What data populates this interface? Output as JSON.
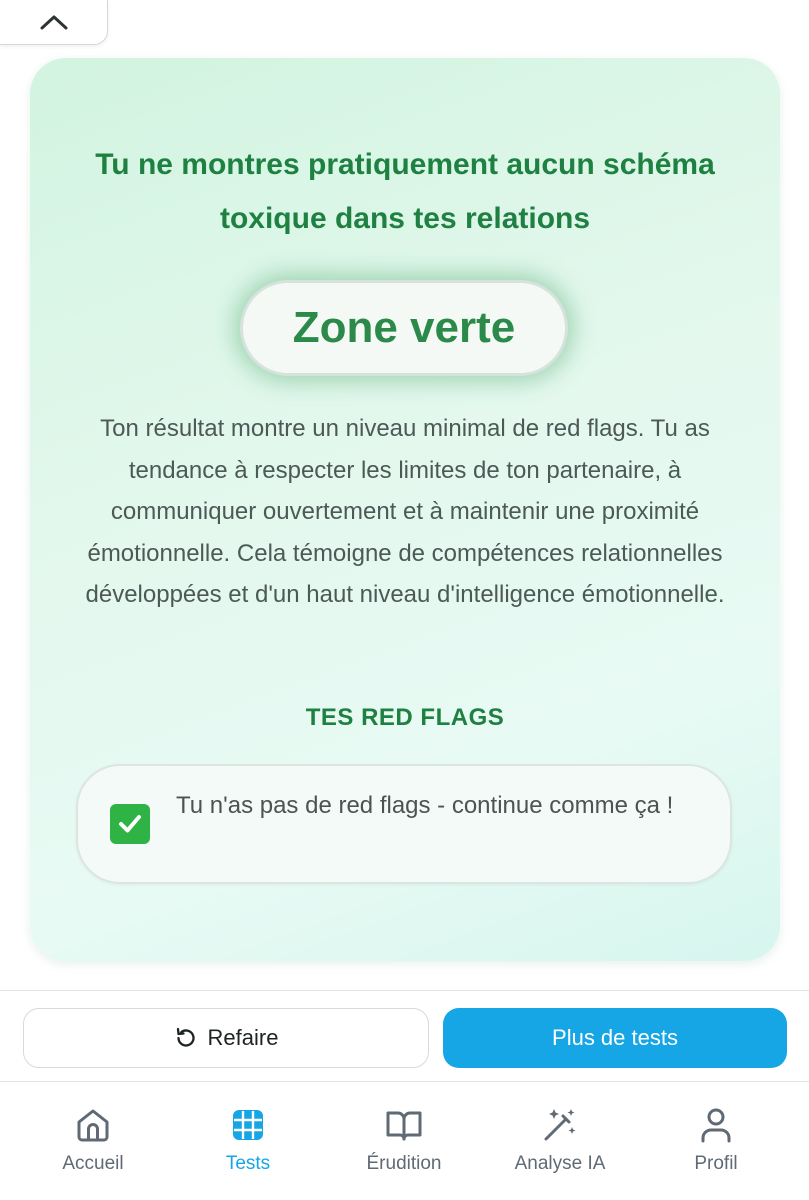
{
  "result": {
    "headline": "Tu ne montres pratiquement aucun schéma toxique dans tes relations",
    "zone_label": "Zone verte",
    "description": "Ton résultat montre un niveau minimal de red flags. Tu as tendance à respecter les limites de ton partenaire, à communiquer ouvertement et à maintenir une proximité émotionnelle. Cela témoigne de compétences relationnelles développées et d'un haut niveau d'intelligence émotionnelle.",
    "flags_title": "TES RED FLAGS",
    "flag_message": "Tu n'as pas de red flags - continue comme ça !"
  },
  "actions": {
    "redo_label": "Refaire",
    "more_label": "Plus de tests"
  },
  "nav": {
    "items": [
      {
        "label": "Accueil",
        "icon": "home-icon"
      },
      {
        "label": "Tests",
        "icon": "grid-icon",
        "active": true
      },
      {
        "label": "Érudition",
        "icon": "book-icon"
      },
      {
        "label": "Analyse IA",
        "icon": "magic-wand-icon"
      },
      {
        "label": "Profil",
        "icon": "user-icon"
      }
    ]
  },
  "colors": {
    "accent_green": "#1e8141",
    "accent_blue": "#16a6e6",
    "nav_inactive": "#5f6a75"
  }
}
